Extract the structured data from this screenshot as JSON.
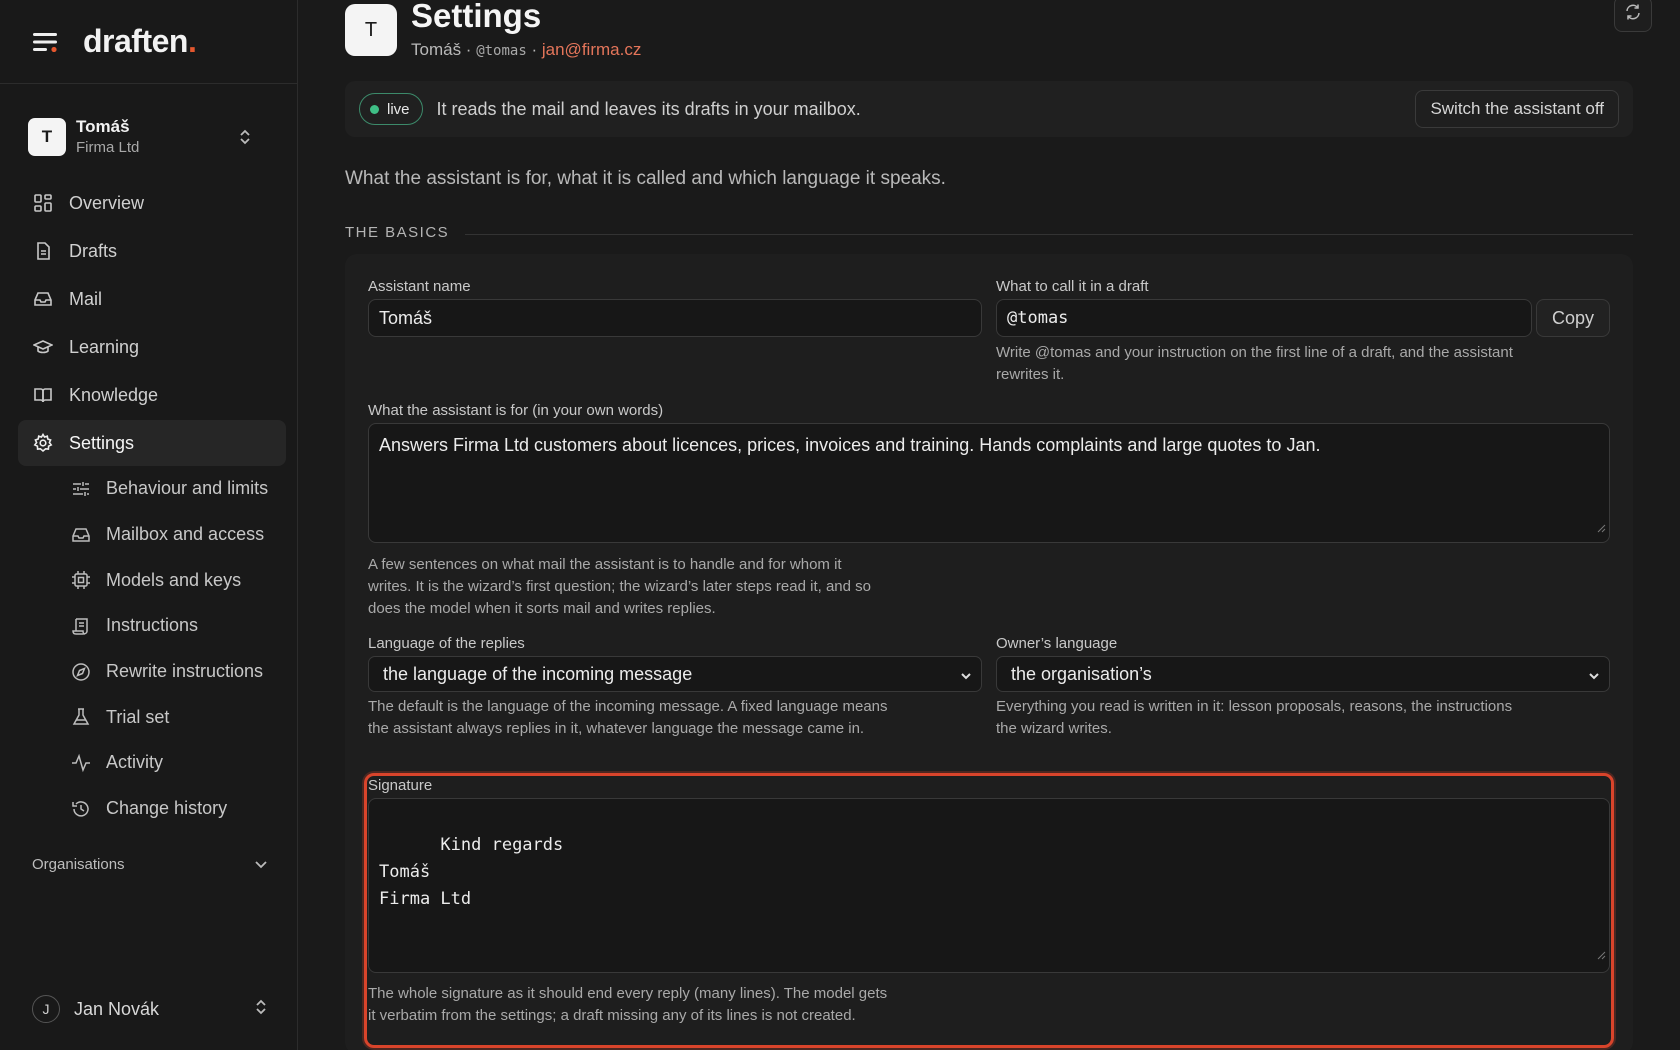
{
  "brand": {
    "name": "draften",
    "dot": "."
  },
  "account": {
    "initial": "T",
    "name": "Tomáš",
    "org": "Firma Ltd"
  },
  "nav": {
    "overview": "Overview",
    "drafts": "Drafts",
    "mail": "Mail",
    "learning": "Learning",
    "knowledge": "Knowledge",
    "settings": "Settings"
  },
  "subnav": {
    "behaviour": "Behaviour and limits",
    "mailbox": "Mailbox and access",
    "models": "Models and keys",
    "instructions": "Instructions",
    "rewrite": "Rewrite instructions",
    "trial": "Trial set",
    "activity": "Activity",
    "history": "Change history"
  },
  "organisations": "Organisations",
  "user": {
    "initial": "J",
    "name": "Jan Novák"
  },
  "header": {
    "initial": "T",
    "title": "Settings",
    "name": "Tomáš",
    "sep1": " · ",
    "handle": "@tomas",
    "sep2": " · ",
    "email": "jan@firma.cz"
  },
  "status": {
    "badge": "live",
    "text": "It reads the mail and leaves its drafts in your mailbox.",
    "switch_label": "Switch the assistant off"
  },
  "intro": "What the assistant is for, what it is called and which language it speaks.",
  "section_title": "THE BASICS",
  "form": {
    "name_label": "Assistant name",
    "name_value": "Tomáš",
    "call_label": "What to call it in a draft",
    "call_value": "@tomas",
    "copy_label": "Copy",
    "call_help": "Write @tomas and your instruction on the first line of a draft, and the assistant rewrites it.",
    "purpose_label": "What the assistant is for (in your own words)",
    "purpose_value": "Answers Firma Ltd customers about licences, prices, invoices and training. Hands complaints and large quotes to Jan.",
    "purpose_help": "A few sentences on what mail the assistant is to handle and for whom it writes. It is the wizard’s first question; the wizard’s later steps read it, and so does the model when it sorts mail and writes replies.",
    "reply_lang_label": "Language of the replies",
    "reply_lang_value": "the language of the incoming message",
    "reply_lang_help": "The default is the language of the incoming message. A fixed language means the assistant always replies in it, whatever language the message came in.",
    "owner_lang_label": "Owner’s language",
    "owner_lang_value": "the organisation’s",
    "owner_lang_help": "Everything you read is written in it: lesson proposals, reasons, the instructions the wizard writes.",
    "signature_label": "Signature",
    "signature_value": "Kind regards\nTomáš\nFirma Ltd",
    "signature_help": "The whole signature as it should end every reply (many lines). The model gets it verbatim from the settings; a draft missing any of its lines is not created."
  },
  "colors": {
    "accent": "#e4572e",
    "live": "#3fbf86",
    "focus": "#d9442b",
    "email": "#e4755a"
  }
}
